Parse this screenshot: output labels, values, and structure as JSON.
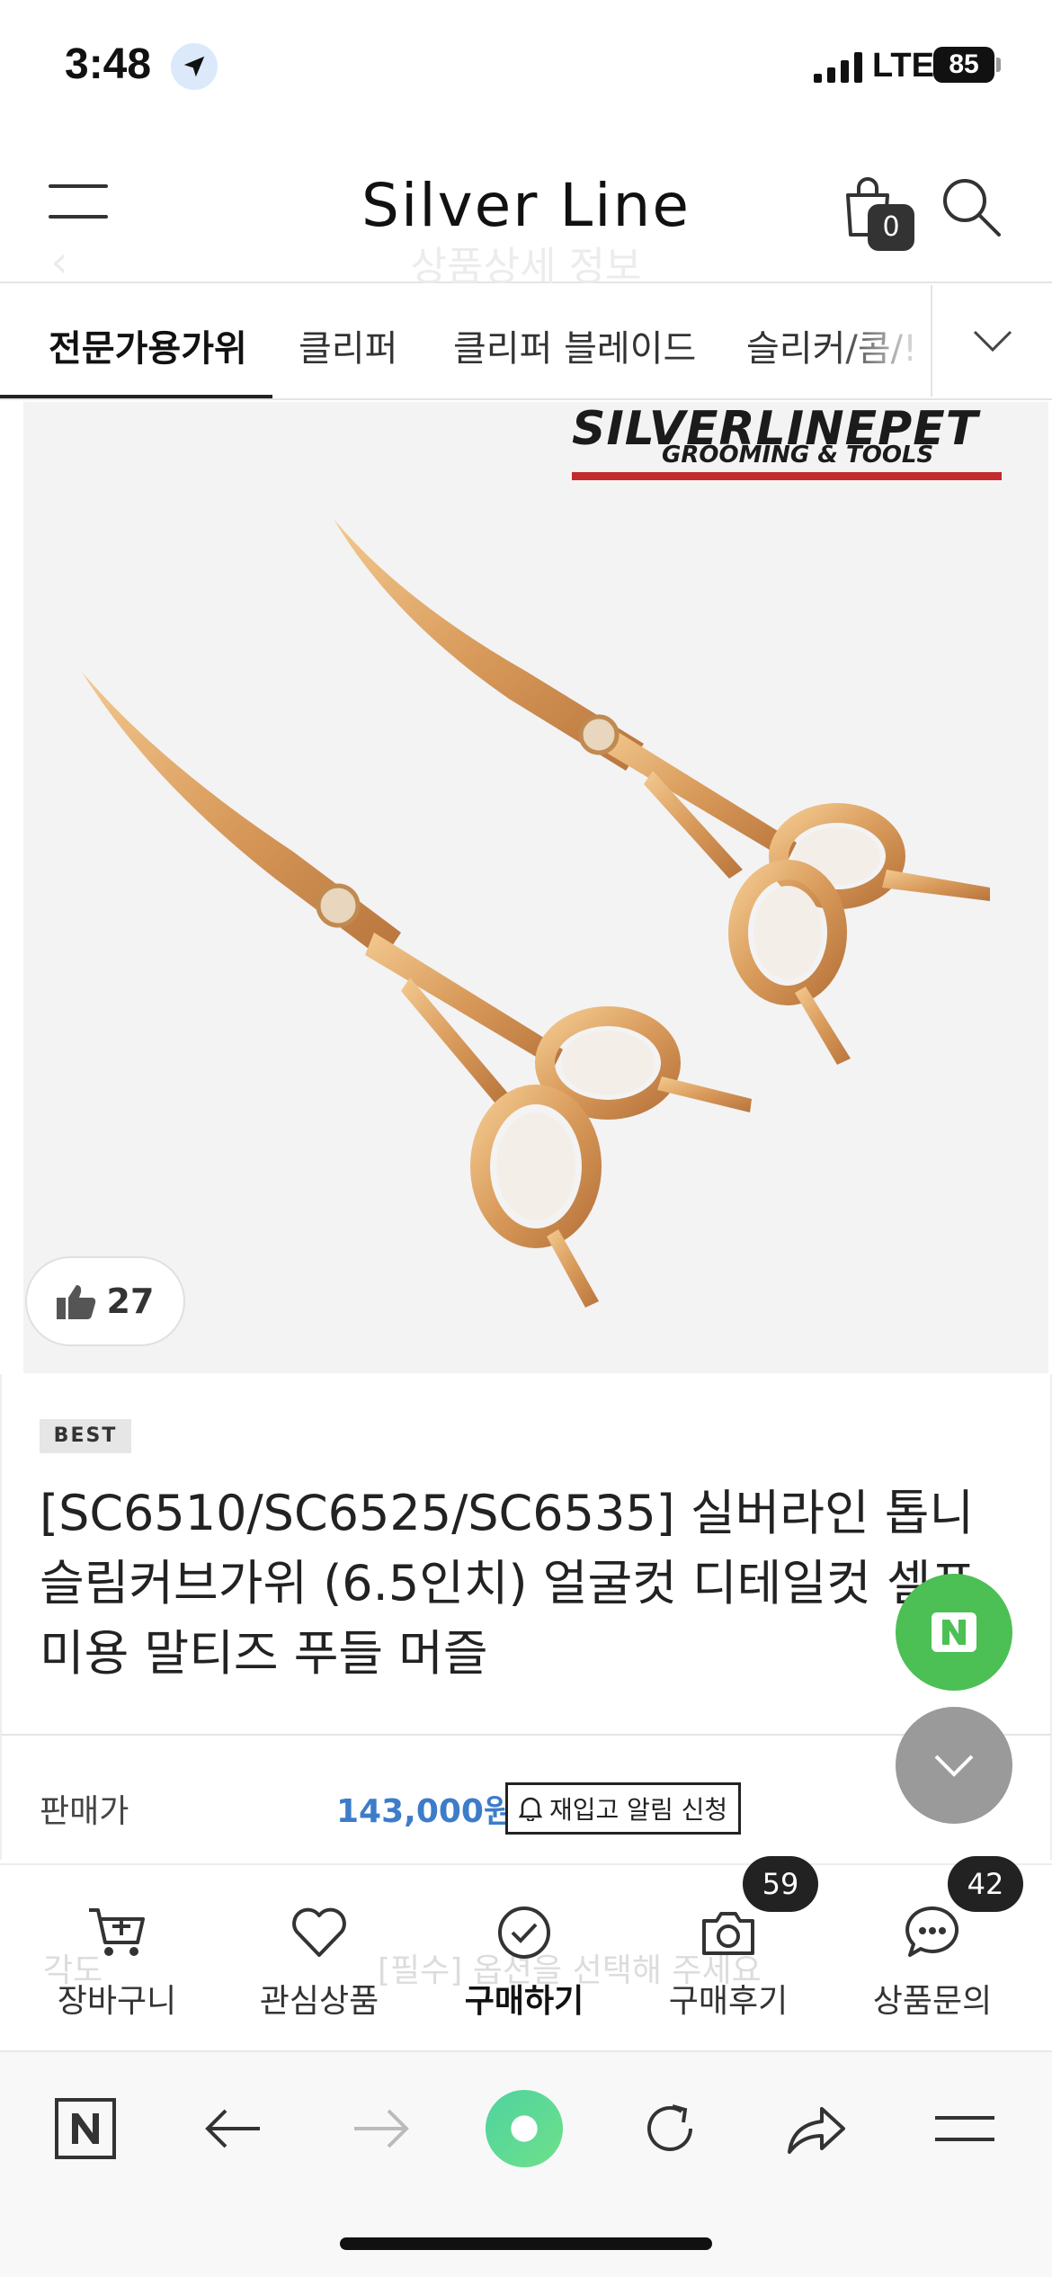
{
  "status_bar": {
    "time": "3:48",
    "network": "LTE",
    "battery": "85"
  },
  "header": {
    "brand": "Silver Line",
    "ghost_title": "상품상세 정보",
    "cart_count": "0"
  },
  "categories": {
    "items": [
      {
        "label": "전문가용가위"
      },
      {
        "label": "클리퍼"
      },
      {
        "label": "클리퍼 블레이드"
      },
      {
        "label": "슬리커/콤/!"
      }
    ]
  },
  "product_image": {
    "logo_title": "SILVERLINEPET",
    "logo_subtitle": "GROOMING & TOOLS",
    "likes": "27"
  },
  "product": {
    "badge": "BEST",
    "title": "[SC6510/SC6525/SC6535] 실버라인 톱니 슬림커브가위 (6.5인치) 얼굴컷 디테일컷 셀프미용 말티즈 푸들 머즐"
  },
  "price": {
    "label": "판매가",
    "value": "143,000원",
    "restock_label": "재입고 알림 신청"
  },
  "options_ghost": {
    "label": "각도",
    "select": "[필수] 옵션을 선택해 주세요"
  },
  "action_bar": {
    "cart": "장바구니",
    "wishlist": "관심상품",
    "buy": "구매하기",
    "reviews": "구매후기",
    "reviews_count": "59",
    "inquiry": "상품문의",
    "inquiry_count": "42"
  },
  "colors": {
    "price": "#3d7cc9",
    "naver_green": "#4cbf55",
    "logo_red": "#c22a2e"
  }
}
